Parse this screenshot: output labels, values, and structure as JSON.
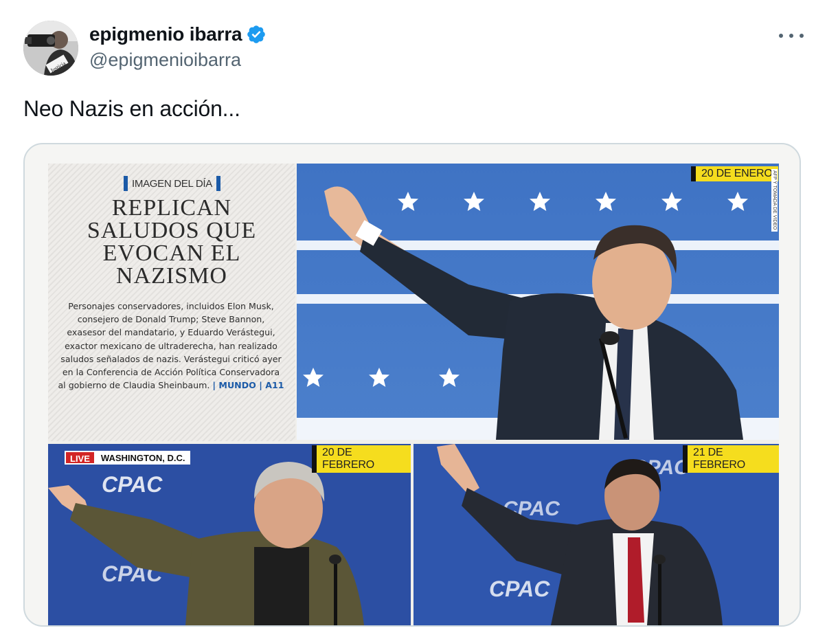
{
  "author": {
    "display_name": "epigmenio ibarra",
    "handle": "@epigmenioibarra",
    "avatar_caption": "Justicia"
  },
  "tweet": {
    "text": "Neo Nazis en acción..."
  },
  "media": {
    "kicker": "IMAGEN DEL DÍA",
    "headline_lines": [
      "REPLICAN",
      "SALUDOS QUE",
      "EVOCAN EL",
      "NAZISMO"
    ],
    "summary": "Personajes conservadores, incluidos Elon Musk, consejero de Donald Trump; Steve Bannon, exasesor del mandatario, y Eduardo Verástegui, exactor mexicano de ultraderecha, han realizado saludos señalados de nazis. Verástegui criticó ayer en la Conferencia de Acción Política Conservadora al gobierno de Claudia Sheinbaum.",
    "section_ref": "| MUNDO | A11",
    "photo_main": {
      "date": "20 DE ENERO",
      "credit": "AFP Y TOMADA DE VIDEO"
    },
    "photo_left": {
      "date": "20 DE FEBRERO",
      "live": "LIVE",
      "location": "WASHINGTON, D.C.",
      "logo": "CPAC"
    },
    "photo_right": {
      "date": "21 DE FEBRERO",
      "logo": "CPAC"
    }
  },
  "colors": {
    "verified": "#1d9bf0",
    "handle": "#536471",
    "accent_blue": "#1b5aa7",
    "date_tag": "#f5dd1e"
  },
  "icons": {
    "verified": "verified-badge-icon",
    "more": "more-options-icon"
  }
}
